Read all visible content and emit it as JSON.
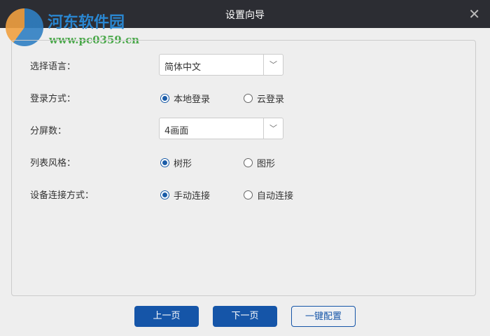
{
  "title": "设置向导",
  "watermark": {
    "name": "河东软件园",
    "url": "www.pc0359.cn"
  },
  "fields": {
    "language": {
      "label": "选择语言：",
      "value": "简体中文"
    },
    "login": {
      "label": "登录方式：",
      "options": [
        "本地登录",
        "云登录"
      ],
      "selected": 0
    },
    "split": {
      "label": "分屏数：",
      "value": "4画面"
    },
    "list_style": {
      "label": "列表风格：",
      "options": [
        "树形",
        "图形"
      ],
      "selected": 0
    },
    "connect": {
      "label": "设备连接方式：",
      "options": [
        "手动连接",
        "自动连接"
      ],
      "selected": 0
    }
  },
  "buttons": {
    "prev": "上一页",
    "next": "下一页",
    "oneclick": "一键配置"
  }
}
